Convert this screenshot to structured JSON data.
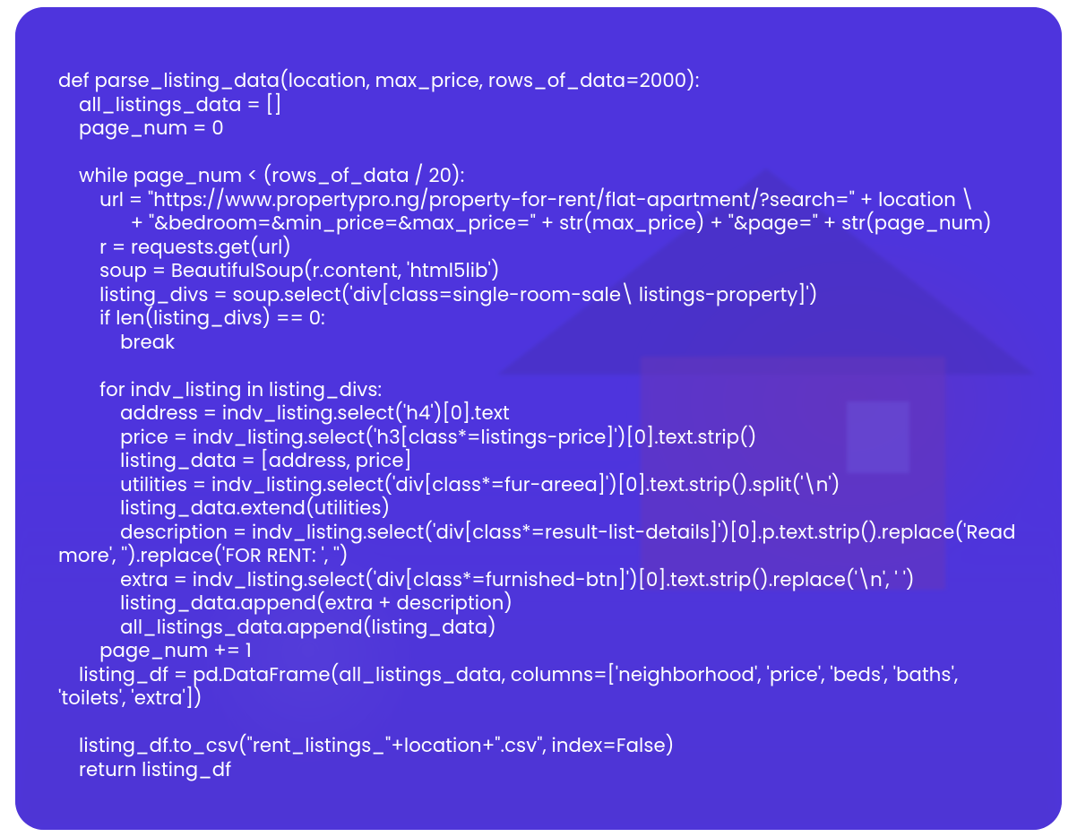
{
  "code_block": {
    "language": "python",
    "lines": [
      "def parse_listing_data(location, max_price, rows_of_data=2000):",
      "    all_listings_data = []",
      "    page_num = 0",
      "",
      "    while page_num < (rows_of_data / 20):",
      "        url = \"https://www.propertypro.ng/property-for-rent/flat-apartment/?search=\" + location \\",
      "              + \"&bedroom=&min_price=&max_price=\" + str(max_price) + \"&page=\" + str(page_num)",
      "        r = requests.get(url)",
      "        soup = BeautifulSoup(r.content, 'html5lib')",
      "        listing_divs = soup.select('div[class=single-room-sale\\ listings-property]')",
      "        if len(listing_divs) == 0:",
      "            break",
      "",
      "        for indv_listing in listing_divs:",
      "            address = indv_listing.select('h4')[0].text",
      "            price = indv_listing.select('h3[class*=listings-price]')[0].text.strip()",
      "            listing_data = [address, price]",
      "            utilities = indv_listing.select('div[class*=fur-areea]')[0].text.strip().split('\\n')",
      "            listing_data.extend(utilities)",
      "            description = indv_listing.select('div[class*=result-list-details]')[0].p.text.strip().replace('Read more', '').replace('FOR RENT: ', '')",
      "            extra = indv_listing.select('div[class*=furnished-btn]')[0].text.strip().replace('\\n', ' ')",
      "            listing_data.append(extra + description)",
      "            all_listings_data.append(listing_data)",
      "        page_num += 1",
      "    listing_df = pd.DataFrame(all_listings_data, columns=['neighborhood', 'price', 'beds', 'baths', 'toilets', 'extra'])",
      "",
      "    listing_df.to_csv(\"rent_listings_\"+location+\".csv\", index=False)",
      "    return listing_df"
    ]
  },
  "colors": {
    "card_bg": "#5a3ee0",
    "overlay": "rgba(74,50,220,0.78)",
    "text": "#ffffff"
  }
}
